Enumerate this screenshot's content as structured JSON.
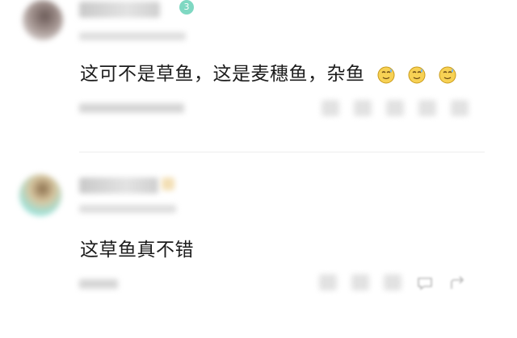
{
  "comments": [
    {
      "level": "3",
      "content": "这可不是草鱼，这是麦穗鱼，杂鱼",
      "emojis": [
        "sweat-smile-icon",
        "sweat-smile-icon",
        "sweat-smile-icon"
      ]
    },
    {
      "content": "这草鱼真不错"
    }
  ],
  "colors": {
    "badge": "#7fd8c2",
    "text": "#1c1c1c",
    "muted": "#9a9a9a"
  }
}
